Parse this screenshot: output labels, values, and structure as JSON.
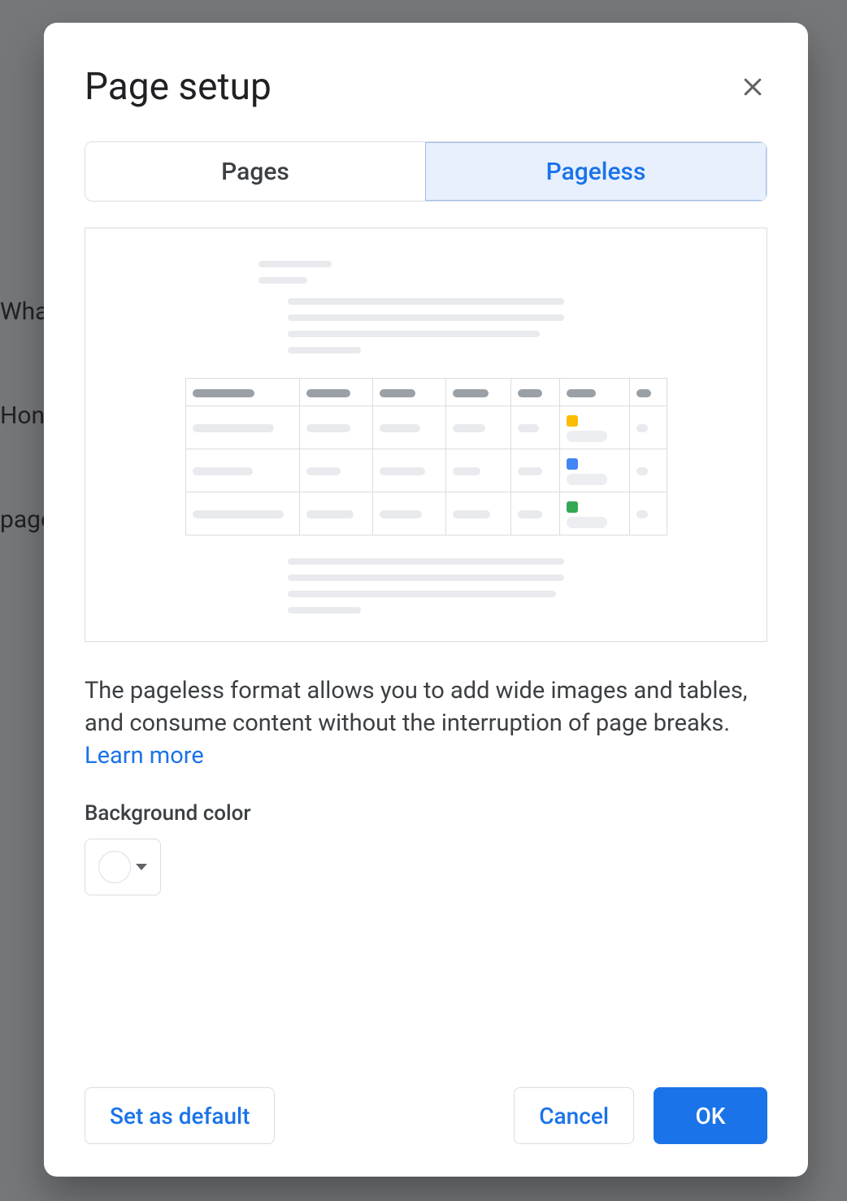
{
  "background": {
    "line1": "Wha",
    "line2": "Hon",
    "line3": "page"
  },
  "dialog": {
    "title": "Page setup",
    "close_label": "Close",
    "tabs": {
      "pages": "Pages",
      "pageless": "Pageless",
      "active": "pageless"
    },
    "description_text": "The pageless format allows you to add wide images and tables, and consume content without the interruption of page breaks. ",
    "learn_more_label": "Learn more",
    "bg_color_label": "Background color",
    "bg_color_value": "#ffffff",
    "actions": {
      "set_default": "Set as default",
      "cancel": "Cancel",
      "ok": "OK"
    }
  }
}
